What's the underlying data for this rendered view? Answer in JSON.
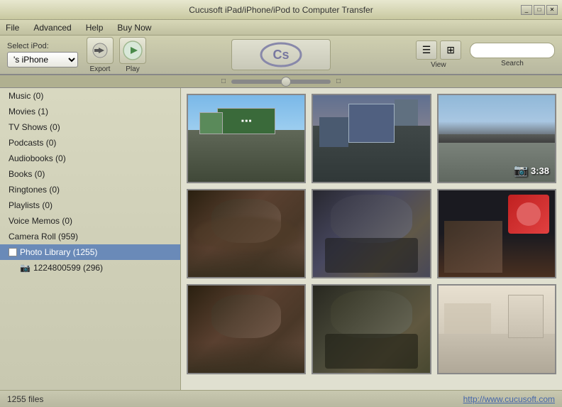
{
  "window": {
    "title": "Cucusoft iPad/iPhone/iPod to Computer Transfer",
    "controls": [
      "_",
      "□",
      "✕"
    ]
  },
  "menubar": {
    "items": [
      "File",
      "Advanced",
      "Help",
      "Buy Now"
    ]
  },
  "toolbar": {
    "ipod_label": "Select iPod:",
    "ipod_value": "'s iPhone",
    "export_label": "Export",
    "play_label": "Play",
    "view_label": "View",
    "search_label": "Search",
    "search_placeholder": ""
  },
  "sidebar": {
    "items": [
      {
        "label": "Music (0)",
        "active": false,
        "sub": false
      },
      {
        "label": "Movies (1)",
        "active": false,
        "sub": false
      },
      {
        "label": "TV Shows (0)",
        "active": false,
        "sub": false
      },
      {
        "label": "Podcasts (0)",
        "active": false,
        "sub": false
      },
      {
        "label": "Audiobooks (0)",
        "active": false,
        "sub": false
      },
      {
        "label": "Books (0)",
        "active": false,
        "sub": false
      },
      {
        "label": "Ringtones (0)",
        "active": false,
        "sub": false
      },
      {
        "label": "Playlists (0)",
        "active": false,
        "sub": false
      },
      {
        "label": "Voice Memos (0)",
        "active": false,
        "sub": false
      },
      {
        "label": "Camera Roll (959)",
        "active": false,
        "sub": false
      },
      {
        "label": "Photo Library (1255)",
        "active": true,
        "sub": false,
        "expanded": true
      },
      {
        "label": "1224800599 (296)",
        "active": false,
        "sub": true
      }
    ]
  },
  "photos": {
    "count": 9,
    "video_duration": "3:38"
  },
  "statusbar": {
    "file_count": "1255 files",
    "link": "http://www.cucusoft.com"
  }
}
